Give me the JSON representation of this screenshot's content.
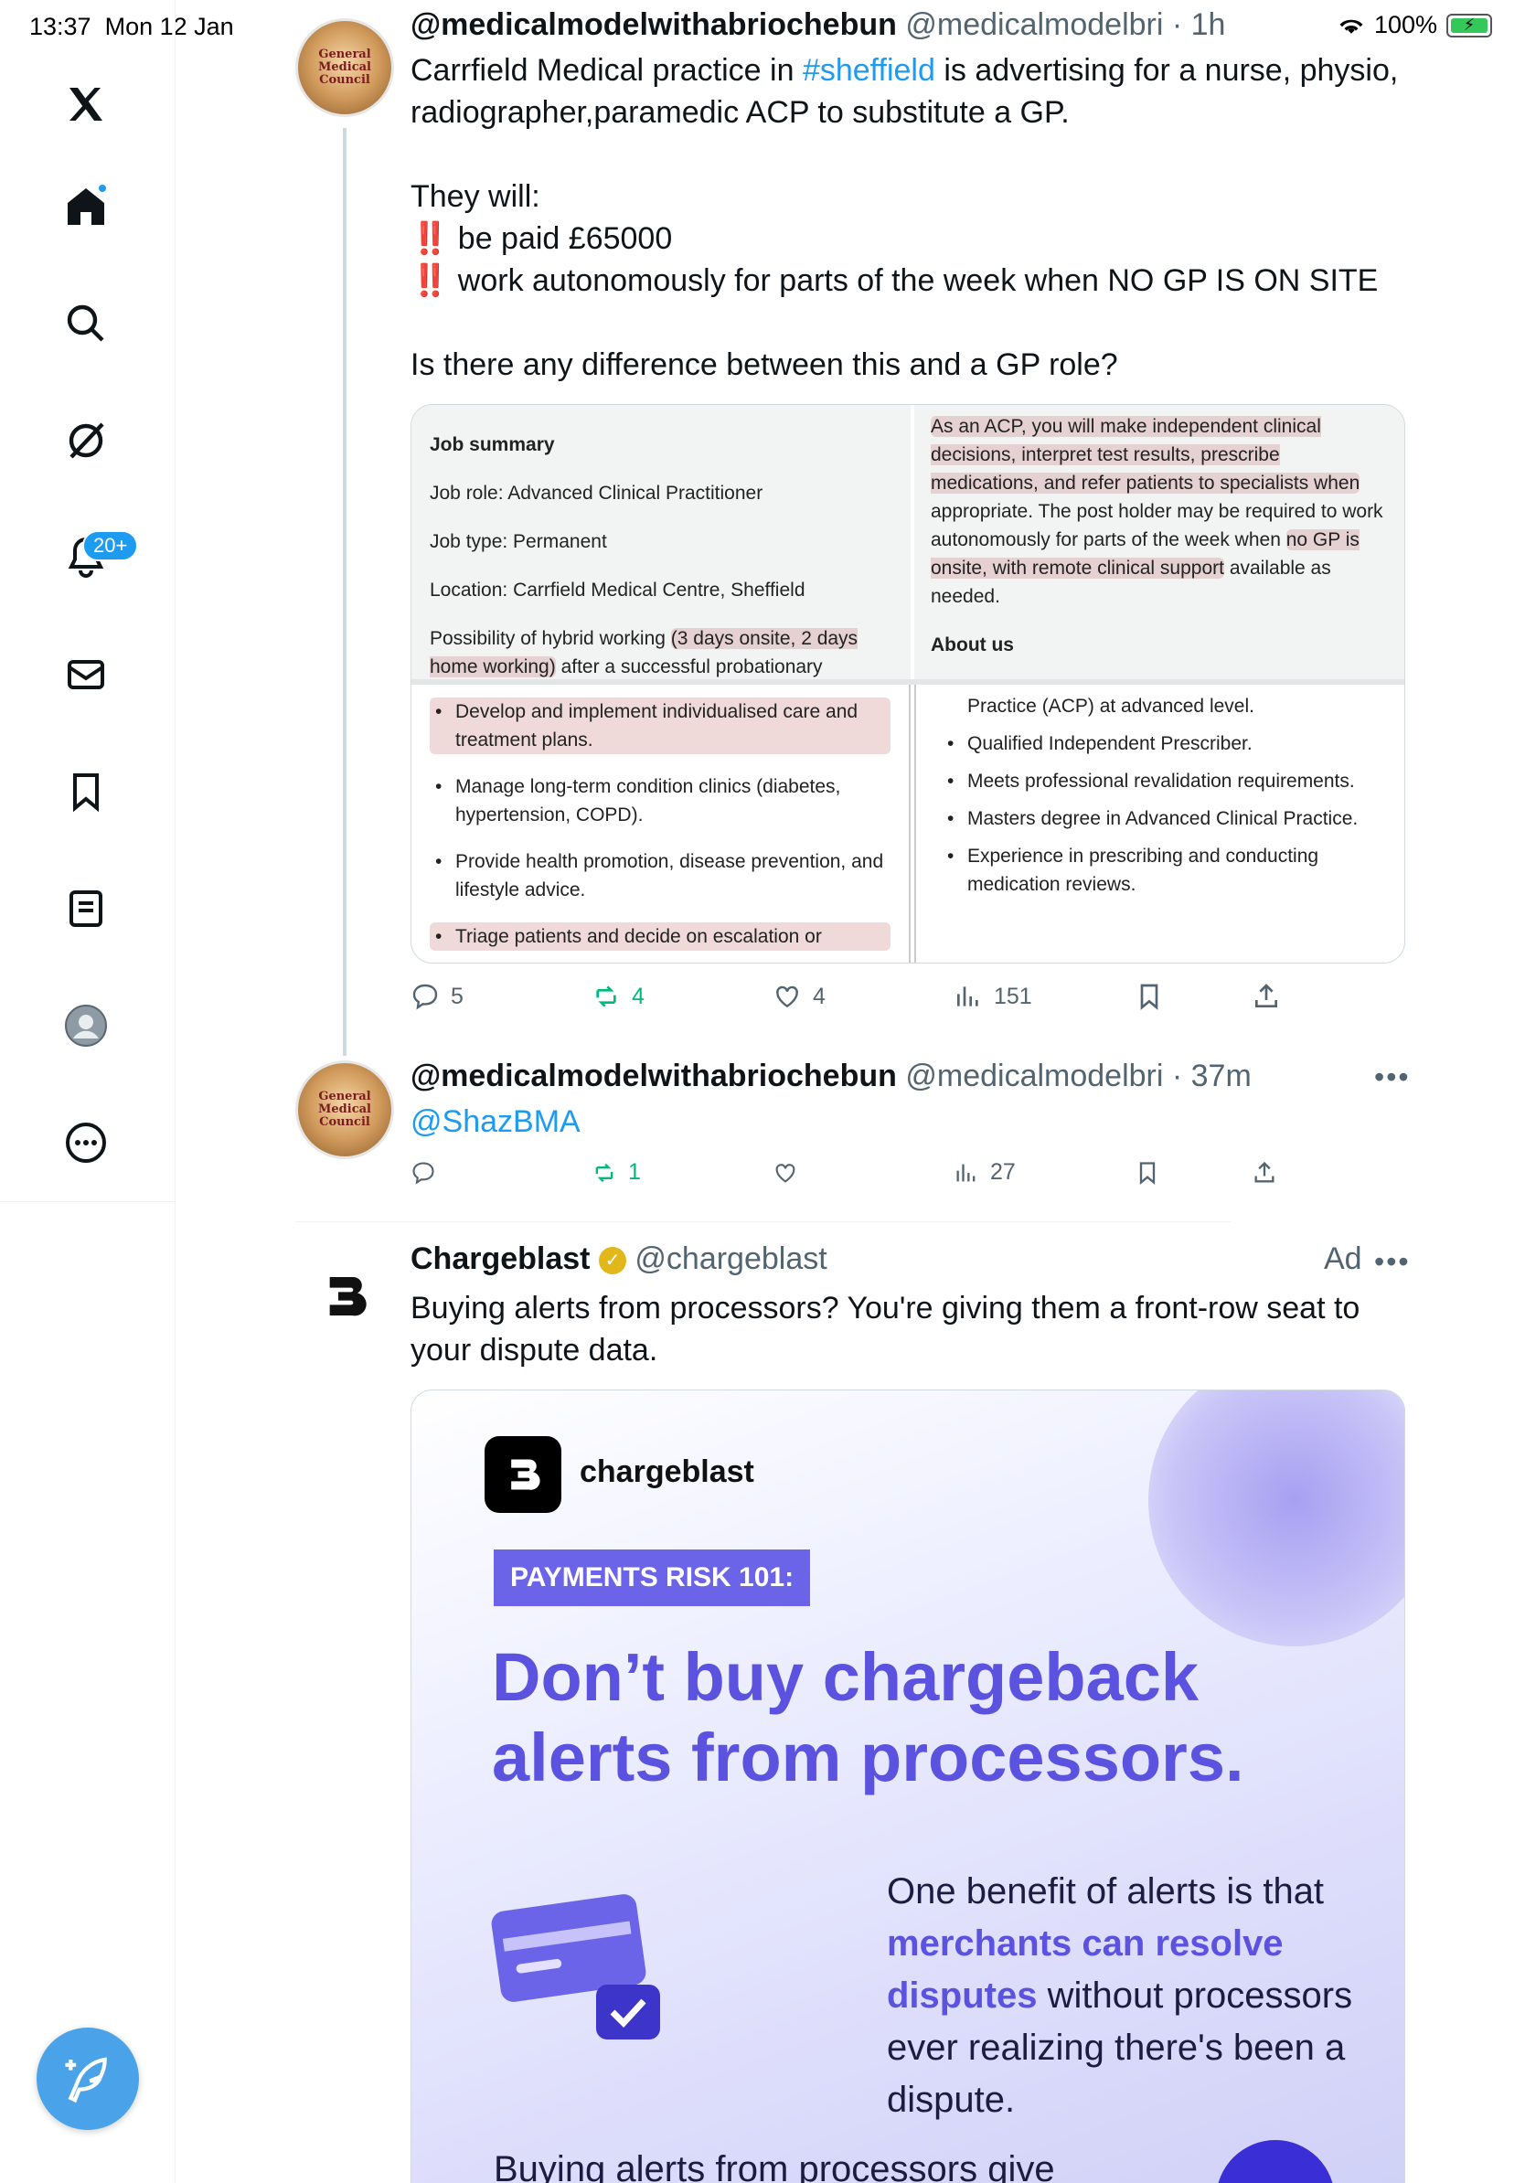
{
  "status_bar": {
    "time": "13:37",
    "date": "Mon 12 Jan",
    "battery": "100%"
  },
  "sidebar": {
    "notifications_badge": "20+",
    "items": [
      "x-logo",
      "home",
      "search",
      "grok",
      "notifications",
      "messages",
      "bookmarks",
      "lists",
      "profile",
      "more"
    ]
  },
  "tweet1": {
    "name": "@medicalmodelwithabriochebun",
    "handle": "@medicalmodelbri",
    "time": "· 1h",
    "avatar_text": "General Medical Council",
    "text_line1_a": "Carrfield Medical practice in ",
    "text_hashtag": "#sheffield",
    "text_line1_b": " is advertising for a nurse, physio, radiographer,paramedic ACP to substitute a GP.",
    "text_line2": "They will:",
    "bang": "‼️",
    "bullet1": " be paid £65000",
    "bullet2": " work autonomously for parts of the week when NO GP IS ON SITE",
    "text_line3": "Is there any difference between this and a GP role?",
    "replies": "5",
    "reposts": "4",
    "likes": "4",
    "views": "151"
  },
  "job_image": {
    "tl_title": "Job summary",
    "tl_role": "Job role: Advanced Clinical Practitioner",
    "tl_type": "Job type: Permanent",
    "tl_location": "Location: Carrfield Medical Centre, Sheffield",
    "tl_hybrid_a": "Possibility of hybrid working ",
    "tl_hybrid_hl": "(3 days onsite, 2 days home working)",
    "tl_hybrid_b": " after a successful probationary",
    "tr_p1_hl": "As an ACP, you will make independent clinical decisions, interpret test results, prescribe medications, and refer patients to specialists when",
    "tr_p1_b": " appropriate. The post holder may be required to work autonomously for parts of the week when ",
    "tr_p1_hl2": "no GP is onsite, with remote clinical support",
    "tr_p1_c": " available as needed.",
    "tr_about": "About us",
    "bl_items": [
      "Develop and implement individualised care and treatment plans.",
      "Manage long-term condition clinics (diabetes, hypertension, COPD).",
      "Provide health promotion, disease prevention, and lifestyle advice.",
      "Triage patients and decide on escalation or"
    ],
    "br_top": "Practice (ACP) at advanced level.",
    "br_items": [
      "Qualified Independent Prescriber.",
      "Meets professional revalidation requirements.",
      "Masters degree in Advanced Clinical Practice.",
      "Experience in prescribing and conducting medication reviews."
    ]
  },
  "tweet2": {
    "name": "@medicalmodelwithabriochebun",
    "handle": "@medicalmodelbri",
    "time": "· 37m",
    "mention": "@ShazBMA",
    "reposts": "1",
    "views": "27"
  },
  "ad": {
    "name": "Chargeblast",
    "handle": "@chargeblast",
    "ad_label": "Ad",
    "text": "Buying alerts from processors? You're giving them a front-row seat to your dispute data.",
    "brand": "chargeblast",
    "pill": "PAYMENTS RISK 101:",
    "headline": "Don’t buy chargeback alerts from processors.",
    "body_a": "One benefit of alerts is that ",
    "body_accent": "merchants can resolve disputes",
    "body_b": " without processors ever realizing there's been a dispute.",
    "footer": "Buying alerts from processors give"
  },
  "colors": {
    "accent": "#1d9bf0",
    "repost": "#00ba7c",
    "ad_purple": "#5b52e0"
  }
}
